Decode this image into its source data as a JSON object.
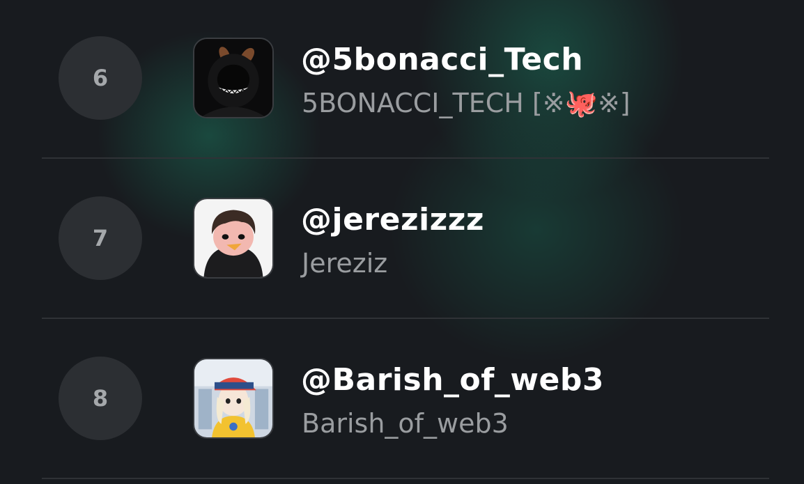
{
  "leaderboard": {
    "rows": [
      {
        "rank": "6",
        "handle": "@5bonacci_Tech",
        "display_name": "5BONACCI_TECH [※🐙※]",
        "avatar_icon": "dark-hooded-grinning-rabbit-avatar"
      },
      {
        "rank": "7",
        "handle": "@jerezizzz",
        "display_name": "Jereziz",
        "avatar_icon": "cartoon-penguin-hoodie-avatar"
      },
      {
        "rank": "8",
        "handle": "@Barish_of_web3",
        "display_name": "Barish_of_web3",
        "avatar_icon": "cartoon-girl-cap-avatar"
      }
    ]
  },
  "colors": {
    "background": "#181b1f",
    "glow": "#1b6e58",
    "rank_badge": "#2c2f33",
    "handle_text": "#ffffff",
    "name_text": "#9a9da0"
  }
}
